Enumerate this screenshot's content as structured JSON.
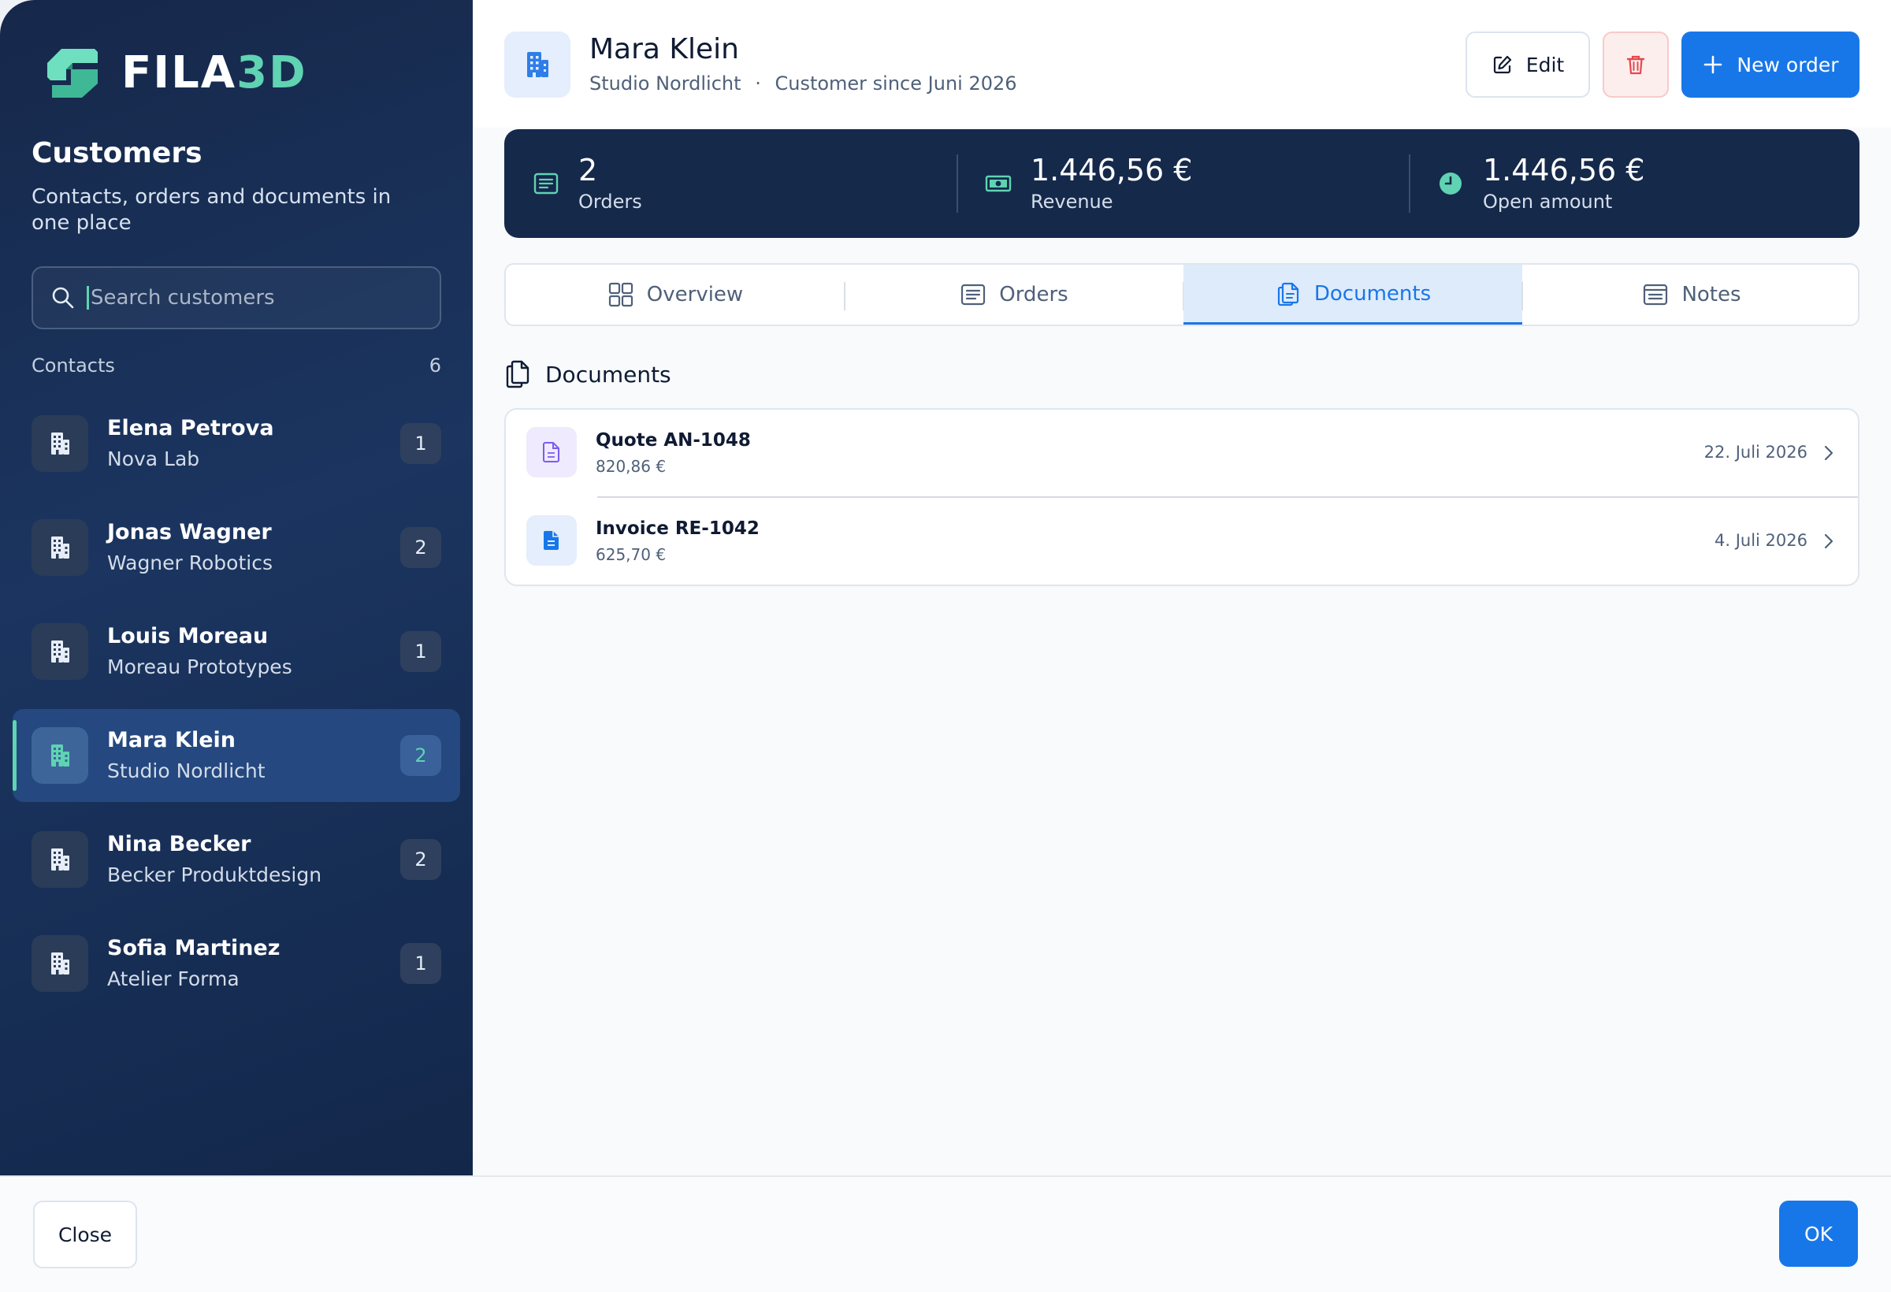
{
  "app": {
    "brand_a": "FILA",
    "brand_b": "3D",
    "accent_color": "#5fd3b2",
    "primary_color": "#1877e8"
  },
  "sidebar": {
    "title": "Customers",
    "subtitle": "Contacts, orders and documents in one place",
    "search": {
      "placeholder": "Search customers",
      "value": ""
    },
    "contacts_label": "Contacts",
    "contacts_count": "6",
    "contacts": [
      {
        "name": "Elena Petrova",
        "company": "Nova Lab",
        "count": "1",
        "active": false
      },
      {
        "name": "Jonas Wagner",
        "company": "Wagner Robotics",
        "count": "2",
        "active": false
      },
      {
        "name": "Louis Moreau",
        "company": "Moreau Prototypes",
        "count": "1",
        "active": false
      },
      {
        "name": "Mara Klein",
        "company": "Studio Nordlicht",
        "count": "2",
        "active": true
      },
      {
        "name": "Nina Becker",
        "company": "Becker Produktdesign",
        "count": "2",
        "active": false
      },
      {
        "name": "Sofia Martinez",
        "company": "Atelier Forma",
        "count": "1",
        "active": false
      }
    ]
  },
  "customer": {
    "name": "Mara Klein",
    "company": "Studio Nordlicht",
    "separator": "·",
    "since": "Customer since Juni 2026"
  },
  "actions": {
    "edit_label": "Edit",
    "new_order_label": "New order"
  },
  "stats": {
    "orders": {
      "value": "2",
      "label": "Orders"
    },
    "revenue": {
      "value": "1.446,56 €",
      "label": "Revenue"
    },
    "open": {
      "value": "1.446,56 €",
      "label": "Open amount"
    }
  },
  "tabs": [
    {
      "label": "Overview",
      "icon": "grid-icon",
      "active": false
    },
    {
      "label": "Orders",
      "icon": "list-icon",
      "active": false
    },
    {
      "label": "Documents",
      "icon": "documents-icon",
      "active": true
    },
    {
      "label": "Notes",
      "icon": "notes-icon",
      "active": false
    }
  ],
  "documents": {
    "title": "Documents",
    "items": [
      {
        "title": "Quote AN-1048",
        "amount": "820,86 €",
        "date": "22. Juli 2026",
        "icon": "quote-doc-icon",
        "color": "#7b5cf0"
      },
      {
        "title": "Invoice RE-1042",
        "amount": "625,70 €",
        "date": "4. Juli 2026",
        "icon": "invoice-doc-icon",
        "color": "#1877e8"
      }
    ]
  },
  "footer": {
    "close_label": "Close",
    "ok_label": "OK"
  }
}
